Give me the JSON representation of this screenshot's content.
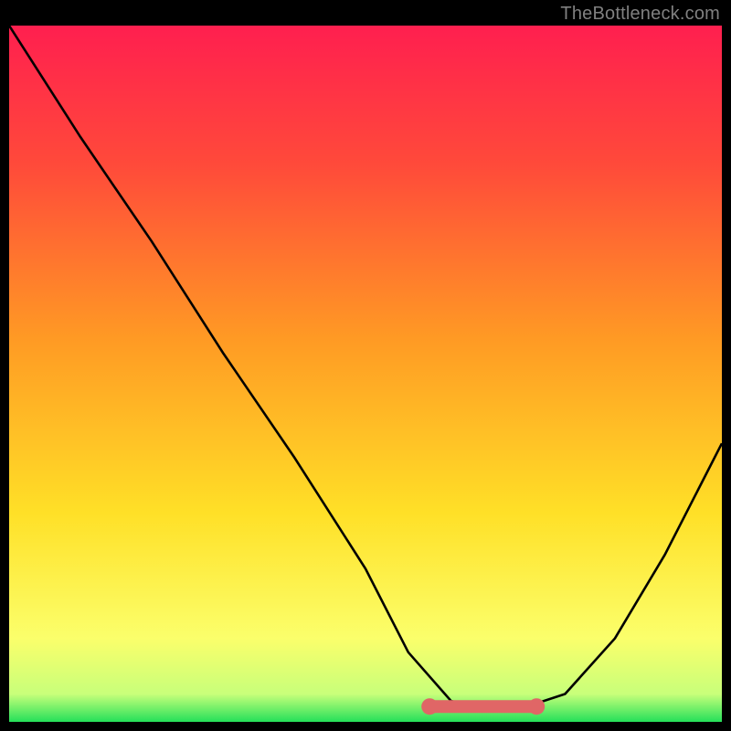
{
  "watermark": "TheBottleneck.com",
  "chart_data": {
    "type": "line",
    "title": "",
    "xlabel": "",
    "ylabel": "",
    "xlim": [
      0,
      1
    ],
    "ylim": [
      0,
      1
    ],
    "grid": false,
    "series": [
      {
        "name": "curve",
        "x": [
          0.0,
          0.1,
          0.2,
          0.3,
          0.4,
          0.5,
          0.56,
          0.62,
          0.66,
          0.72,
          0.78,
          0.85,
          0.92,
          1.0
        ],
        "y": [
          1.0,
          0.84,
          0.69,
          0.53,
          0.38,
          0.22,
          0.1,
          0.03,
          0.02,
          0.02,
          0.04,
          0.12,
          0.24,
          0.4
        ]
      }
    ],
    "highlight": {
      "xrange": [
        0.59,
        0.74
      ],
      "y": 0.022
    },
    "gradient_stops": [
      {
        "pos": 0.0,
        "color": "#ff1f4f"
      },
      {
        "pos": 0.2,
        "color": "#ff4a3a"
      },
      {
        "pos": 0.45,
        "color": "#ff9a24"
      },
      {
        "pos": 0.7,
        "color": "#ffe027"
      },
      {
        "pos": 0.88,
        "color": "#fbff6b"
      },
      {
        "pos": 0.96,
        "color": "#c8ff7a"
      },
      {
        "pos": 1.0,
        "color": "#25e05a"
      }
    ]
  }
}
